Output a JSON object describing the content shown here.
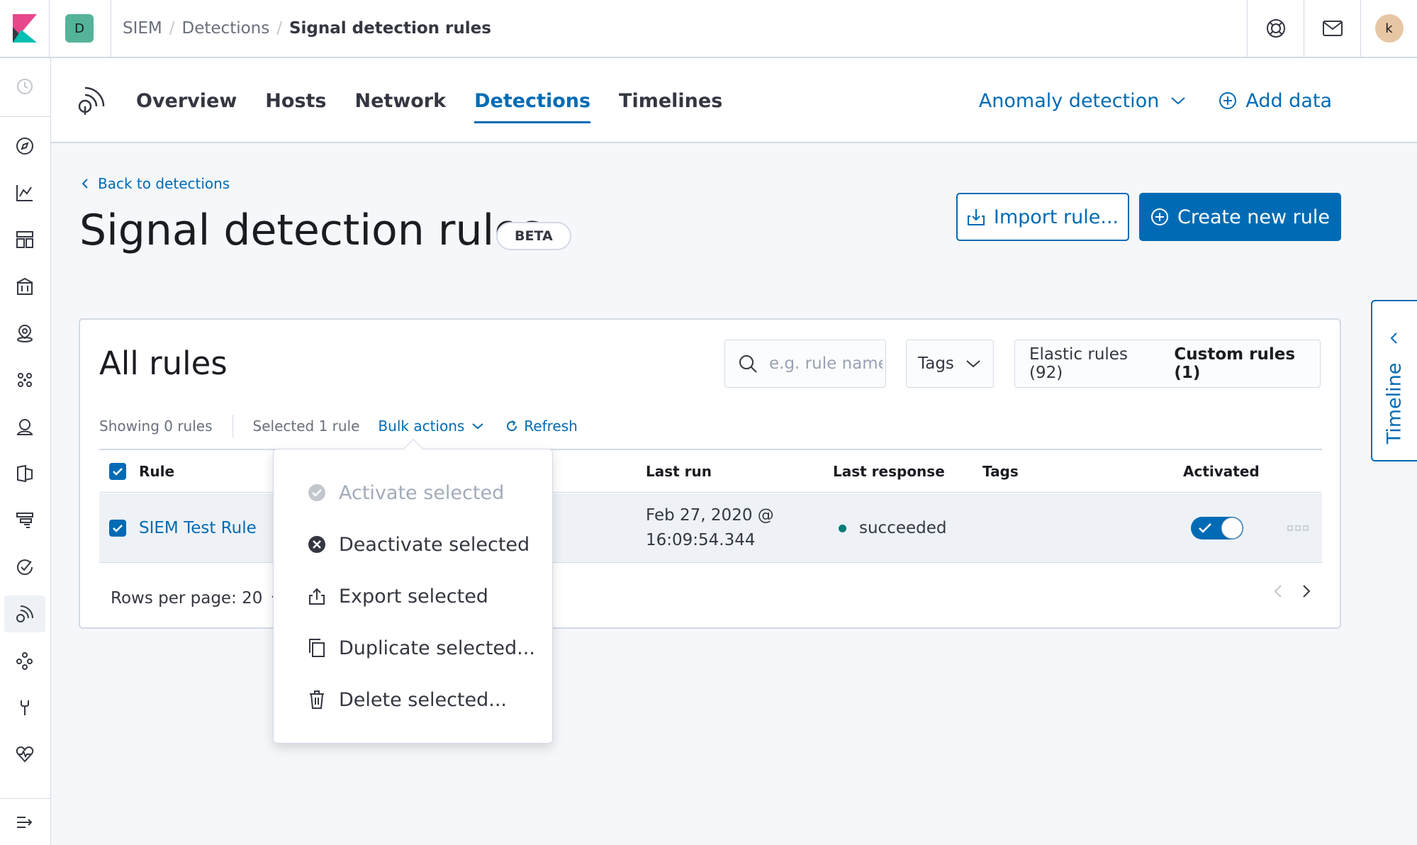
{
  "header": {
    "space_initial": "D",
    "breadcrumbs": [
      "SIEM",
      "Detections",
      "Signal detection rules"
    ],
    "user_initial": "k"
  },
  "app_nav": {
    "tabs": [
      "Overview",
      "Hosts",
      "Network",
      "Detections",
      "Timelines"
    ],
    "active_tab": "Detections",
    "anomaly_label": "Anomaly detection",
    "add_data_label": "Add data"
  },
  "page": {
    "back_label": "Back to detections",
    "title": "Signal detection rules",
    "badge": "BETA",
    "import_label": "Import rule...",
    "create_label": "Create new rule"
  },
  "timeline_tab": {
    "label": "Timeline"
  },
  "rules_panel": {
    "title": "All rules",
    "search_placeholder": "e.g. rule name",
    "tags_label": "Tags",
    "elastic_rules_label": "Elastic rules (92)",
    "custom_rules_label": "Custom rules (1)",
    "showing_label": "Showing 0 rules",
    "selected_label": "Selected 1 rule",
    "bulk_actions_label": "Bulk actions",
    "refresh_label": "Refresh",
    "columns": {
      "rule": "Rule",
      "last_run": "Last run",
      "last_response": "Last response",
      "tags": "Tags",
      "activated": "Activated"
    },
    "rows": [
      {
        "rule": "SIEM Test Rule",
        "last_run_line1": "Feb 27, 2020 @",
        "last_run_line2": "16:09:54.344",
        "last_response": "succeeded",
        "activated": true
      }
    ],
    "rows_per_page_label": "Rows per page: 20"
  },
  "bulk_menu": {
    "items": [
      {
        "label": "Activate selected",
        "icon": "check-circle-icon",
        "disabled": true
      },
      {
        "label": "Deactivate selected",
        "icon": "cross-circle-icon",
        "disabled": false
      },
      {
        "label": "Export selected",
        "icon": "export-icon",
        "disabled": false
      },
      {
        "label": "Duplicate selected...",
        "icon": "copy-icon",
        "disabled": false
      },
      {
        "label": "Delete selected...",
        "icon": "trash-icon",
        "disabled": false
      }
    ]
  },
  "colors": {
    "accent": "#006bb4",
    "success": "#017d73",
    "space": "#54b399",
    "kibana_pink": "#e8478b",
    "kibana_teal": "#00bfb3"
  }
}
